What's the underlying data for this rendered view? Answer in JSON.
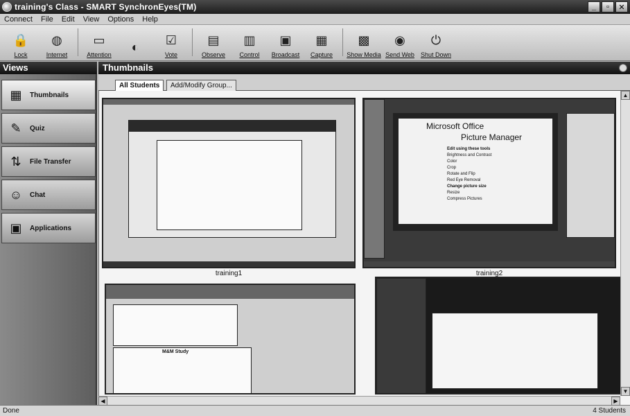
{
  "window": {
    "title": "training's Class - SMART SynchronEyes(TM)"
  },
  "menu": [
    "Connect",
    "File",
    "Edit",
    "View",
    "Options",
    "Help"
  ],
  "toolbar": {
    "items": [
      {
        "label": "Lock",
        "icon": "lock-icon"
      },
      {
        "label": "Internet",
        "icon": "globe-icon"
      },
      {
        "label": "Attention",
        "icon": "attention-icon"
      },
      {
        "label": "",
        "icon": "control-icon"
      },
      {
        "label": "Vote",
        "icon": "vote-icon"
      },
      {
        "label": "Observe",
        "icon": "observe-icon"
      },
      {
        "label": "Control",
        "icon": "control-screen-icon"
      },
      {
        "label": "Broadcast",
        "icon": "broadcast-icon"
      },
      {
        "label": "Capture",
        "icon": "capture-icon"
      },
      {
        "label": "Show Media",
        "icon": "media-icon"
      },
      {
        "label": "Send Web",
        "icon": "web-icon"
      },
      {
        "label": "Shut Down",
        "icon": "power-icon"
      }
    ]
  },
  "sidebar": {
    "header": "Views",
    "items": [
      {
        "label": "Thumbnails",
        "icon": "thumbnails-icon"
      },
      {
        "label": "Quiz",
        "icon": "quiz-icon"
      },
      {
        "label": "File Transfer",
        "icon": "file-transfer-icon"
      },
      {
        "label": "Chat",
        "icon": "chat-icon"
      },
      {
        "label": "Applications",
        "icon": "applications-icon"
      }
    ]
  },
  "panel": {
    "header": "Thumbnails",
    "tabs": [
      "All Students",
      "Add/Modify Group..."
    ]
  },
  "thumbnails": [
    {
      "name": "training1"
    },
    {
      "name": "training2",
      "slide_title": "Microsoft Office",
      "slide_subtitle": "Picture Manager",
      "menu_heading": "Edit using these tools",
      "menu_items": [
        "Brightness and Contrast",
        "Color",
        "Crop",
        "Rotate and Flip",
        "Red Eye Removal"
      ],
      "menu_heading2": "Change picture size",
      "menu_items2": [
        "Resize",
        "Compress Pictures"
      ]
    },
    {
      "name": "",
      "chart_title": "M&M Study"
    },
    {
      "name": ""
    }
  ],
  "status": {
    "left": "Done",
    "right": "4 Students"
  }
}
